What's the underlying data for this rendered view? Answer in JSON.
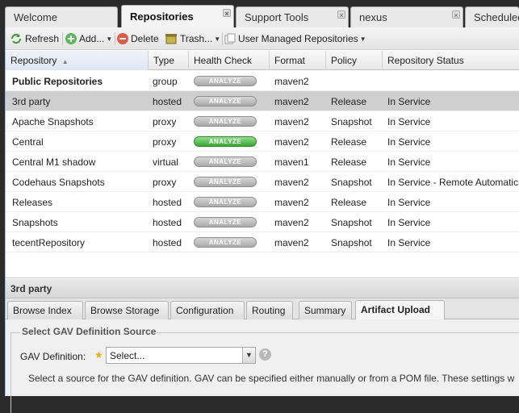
{
  "top_tabs": [
    {
      "label": "Welcome"
    },
    {
      "label": "Repositories"
    },
    {
      "label": "Support Tools"
    },
    {
      "label": "nexus"
    },
    {
      "label": "Scheduled"
    }
  ],
  "toolbar": {
    "refresh": "Refresh",
    "add": "Add...",
    "delete": "Delete",
    "trash": "Trash...",
    "user_managed": "User Managed Repositories"
  },
  "grid": {
    "columns": [
      "Repository",
      "Type",
      "Health Check",
      "Format",
      "Policy",
      "Repository Status"
    ],
    "rows": [
      {
        "repository": "Public Repositories",
        "type": "group",
        "health": "ANALYZE",
        "format": "maven2",
        "policy": "",
        "status": ""
      },
      {
        "repository": "3rd party",
        "type": "hosted",
        "health": "ANALYZE",
        "format": "maven2",
        "policy": "Release",
        "status": "In Service"
      },
      {
        "repository": "Apache Snapshots",
        "type": "proxy",
        "health": "ANALYZE",
        "format": "maven2",
        "policy": "Snapshot",
        "status": "In Service"
      },
      {
        "repository": "Central",
        "type": "proxy",
        "health": "ANALYZE",
        "format": "maven2",
        "policy": "Release",
        "status": "In Service"
      },
      {
        "repository": "Central M1 shadow",
        "type": "virtual",
        "health": "ANALYZE",
        "format": "maven1",
        "policy": "Release",
        "status": "In Service"
      },
      {
        "repository": "Codehaus Snapshots",
        "type": "proxy",
        "health": "ANALYZE",
        "format": "maven2",
        "policy": "Snapshot",
        "status": "In Service - Remote Automatic"
      },
      {
        "repository": "Releases",
        "type": "hosted",
        "health": "ANALYZE",
        "format": "maven2",
        "policy": "Release",
        "status": "In Service"
      },
      {
        "repository": "Snapshots",
        "type": "hosted",
        "health": "ANALYZE",
        "format": "maven2",
        "policy": "Snapshot",
        "status": "In Service"
      },
      {
        "repository": "tecentRepository",
        "type": "hosted",
        "health": "ANALYZE",
        "format": "maven2",
        "policy": "Snapshot",
        "status": "In Service"
      }
    ]
  },
  "detail": {
    "title": "3rd party",
    "tabs": [
      "Browse Index",
      "Browse Storage",
      "Configuration",
      "Routing",
      "Summary",
      "Artifact Upload"
    ],
    "section_title": "Select GAV Definition Source",
    "gav_label": "GAV Definition:",
    "gav_value": "Select...",
    "help": "?",
    "description": "Select a source for the GAV definition. GAV can be specified either manually or from a POM file. These settings w"
  },
  "colors": {
    "analyze_active": "#3aa535",
    "analyze_inactive": "#a9a9a9",
    "selected_row": "#cfcfcf"
  },
  "icons": [
    "close-icon",
    "refresh-icon",
    "add-icon",
    "delete-icon",
    "trash-icon",
    "document-icon",
    "sort-asc-icon",
    "dropdown-arrow-icon",
    "help-icon",
    "required-star-icon"
  ]
}
